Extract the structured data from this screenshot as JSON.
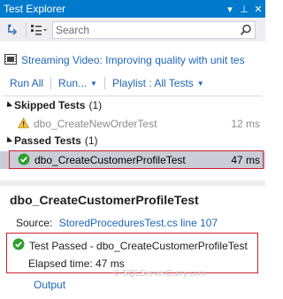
{
  "window": {
    "title": "Test Explorer",
    "controls": {
      "dropdown": "▾",
      "pin": "⊥",
      "close": "✕"
    }
  },
  "toolbar": {
    "search_placeholder": "Search",
    "icons": [
      "run-tests-icon",
      "group-by-icon",
      "search-icon"
    ]
  },
  "playlist_bar": {
    "text": "Streaming Video: Improving quality with unit tes"
  },
  "actions": {
    "run_all": "Run All",
    "run": "Run...",
    "playlist": "Playlist : All Tests"
  },
  "groups": [
    {
      "name": "Skipped Tests",
      "count": "(1)",
      "tests": [
        {
          "name": "dbo_CreateNewOrderTest",
          "duration": "12 ms",
          "status": "skipped"
        }
      ]
    },
    {
      "name": "Passed Tests",
      "count": "(1)",
      "tests": [
        {
          "name": "dbo_CreateCustomerProfileTest",
          "duration": "47 ms",
          "status": "passed",
          "selected": true
        }
      ]
    }
  ],
  "details": {
    "title": "dbo_CreateCustomerProfileTest",
    "source_label": "Source:",
    "source_link": "StoredProceduresTest.cs line 107",
    "result": "Test Passed - dbo_CreateCustomerProfileTest",
    "elapsed": "Elapsed time: 47 ms",
    "output": "Output"
  },
  "watermark": "© SQLServerCurry.com",
  "colors": {
    "accent": "#007acc",
    "link": "#1e66b5",
    "pass": "#2f9e2f",
    "warning": "#e0a020",
    "highlight_border": "#d0202a",
    "selected_row": "#ccccd6"
  }
}
